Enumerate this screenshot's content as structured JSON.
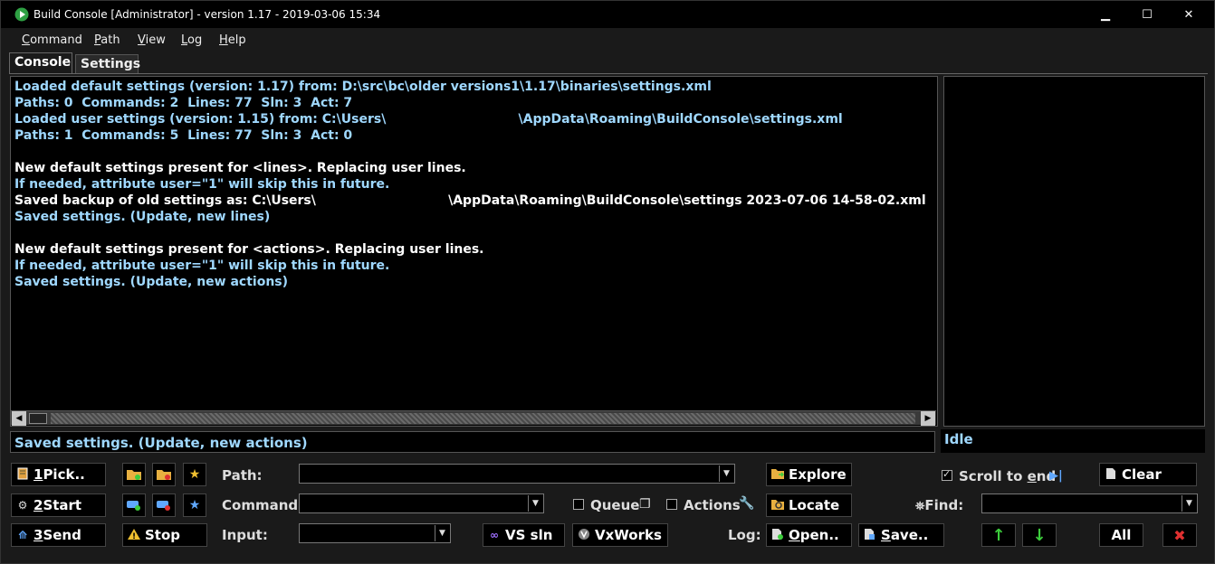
{
  "window": {
    "title": "Build Console [Administrator] - version 1.17 - 2019-03-06 15:34",
    "minimize_glyph": "▁",
    "maximize_glyph": "☐",
    "close_glyph": "✕"
  },
  "menu": {
    "items": [
      {
        "mnemonic": "C",
        "rest": "ommand"
      },
      {
        "mnemonic": "P",
        "rest": "ath"
      },
      {
        "mnemonic": "V",
        "rest": "iew"
      },
      {
        "mnemonic": "L",
        "rest": "og"
      },
      {
        "mnemonic": "H",
        "rest": "elp"
      }
    ]
  },
  "tabs": {
    "console": "Console",
    "settings": "Settings"
  },
  "console_lines": [
    {
      "text": "Loaded default settings (version: 1.17) from: D:\\src\\bc\\older versions1\\1.17\\binaries\\settings.xml",
      "color": "c-blue"
    },
    {
      "text": "Paths: 0  Commands: 2  Lines: 77  Sln: 3  Act: 7",
      "color": "c-blue"
    },
    {
      "text": "Loaded user settings (version: 1.15) from: C:\\Users\\                              \\AppData\\Roaming\\BuildConsole\\settings.xml",
      "color": "c-blue"
    },
    {
      "text": "Paths: 1  Commands: 5  Lines: 77  Sln: 3  Act: 0",
      "color": "c-blue"
    },
    {
      "text": "",
      "color": "c-blue"
    },
    {
      "text": "New default settings present for <lines>. Replacing user lines.",
      "color": "c-white"
    },
    {
      "text": "If needed, attribute user=\"1\" will skip this in future.",
      "color": "c-blue"
    },
    {
      "text": "Saved backup of old settings as: C:\\Users\\                              \\AppData\\Roaming\\BuildConsole\\settings 2023-07-06 14-58-02.xml",
      "color": "c-white"
    },
    {
      "text": "Saved settings. (Update, new lines)",
      "color": "c-blue"
    },
    {
      "text": "",
      "color": "c-blue"
    },
    {
      "text": "New default settings present for <actions>. Replacing user lines.",
      "color": "c-white"
    },
    {
      "text": "If needed, attribute user=\"1\" will skip this in future.",
      "color": "c-blue"
    },
    {
      "text": "Saved settings. (Update, new actions)",
      "color": "c-blue"
    }
  ],
  "status": {
    "last_message": "Saved settings. (Update, new actions)",
    "state": "Idle"
  },
  "buttons": {
    "pick": {
      "num": "1",
      "label": " Pick.."
    },
    "start": {
      "num": "2",
      "label": " Start"
    },
    "send": {
      "num": "3",
      "label": " Send"
    },
    "stop": "Stop",
    "vs_sln": "VS sln",
    "vxworks": "VxWorks",
    "explore": "Explore",
    "locate": "Locate",
    "open": {
      "mnemonic": "O",
      "rest": "pen.."
    },
    "save": {
      "mnemonic": "S",
      "rest": "ave.."
    },
    "clear": "Clear",
    "all": "All"
  },
  "labels": {
    "path": "Path:",
    "command": "Command:",
    "input": "Input:",
    "log": "Log:",
    "find": "Find:",
    "queue": "Queue",
    "actions": "Actions",
    "scroll_to_end": {
      "before": "Scroll to ",
      "mnemonic": "e",
      "after": "nd"
    }
  },
  "fields": {
    "path": "",
    "command": "",
    "input": "",
    "find": ""
  },
  "checks": {
    "queue": false,
    "actions": false,
    "scroll_to_end": true
  },
  "icons": {
    "up_arrow": "↑",
    "down_arrow": "↓",
    "delete": "✖",
    "star": "★"
  },
  "colors": {
    "console_blue": "#9fd8ff",
    "console_white": "#ffffff",
    "arrow_green": "#3ccc3c",
    "delete_red": "#e03030",
    "star_yellow": "#f0c030",
    "star_blue": "#60a8ff"
  }
}
